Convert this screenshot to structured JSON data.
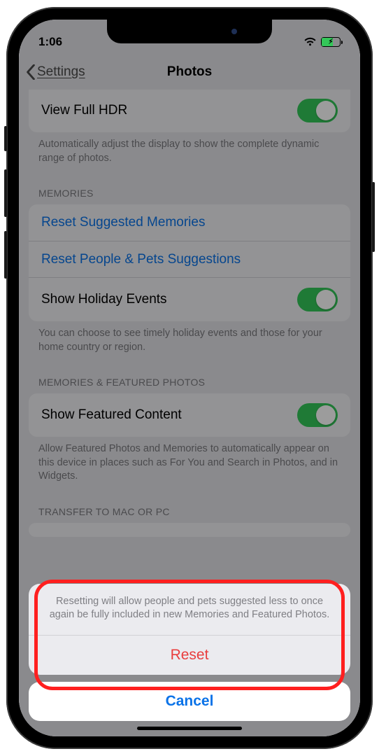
{
  "status": {
    "time": "1:06"
  },
  "nav": {
    "back_label": "Settings",
    "title": "Photos"
  },
  "hdr": {
    "row_label": "View Full HDR",
    "footer": "Automatically adjust the display to show the complete dynamic range of photos."
  },
  "memories": {
    "header": "MEMORIES",
    "reset_suggested": "Reset Suggested Memories",
    "reset_people": "Reset People & Pets Suggestions",
    "holiday_label": "Show Holiday Events",
    "footer": "You can choose to see timely holiday events and those for your home country or region."
  },
  "featured": {
    "header": "MEMORIES & FEATURED PHOTOS",
    "label": "Show Featured Content",
    "footer": "Allow Featured Photos and Memories to automatically appear on this device in places such as For You and Search in Photos, and in Widgets."
  },
  "transfer": {
    "header": "TRANSFER TO MAC OR PC"
  },
  "sheet": {
    "message": "Resetting will allow people and pets suggested less to once again be fully included in new Memories and Featured Photos.",
    "reset": "Reset",
    "cancel": "Cancel"
  }
}
